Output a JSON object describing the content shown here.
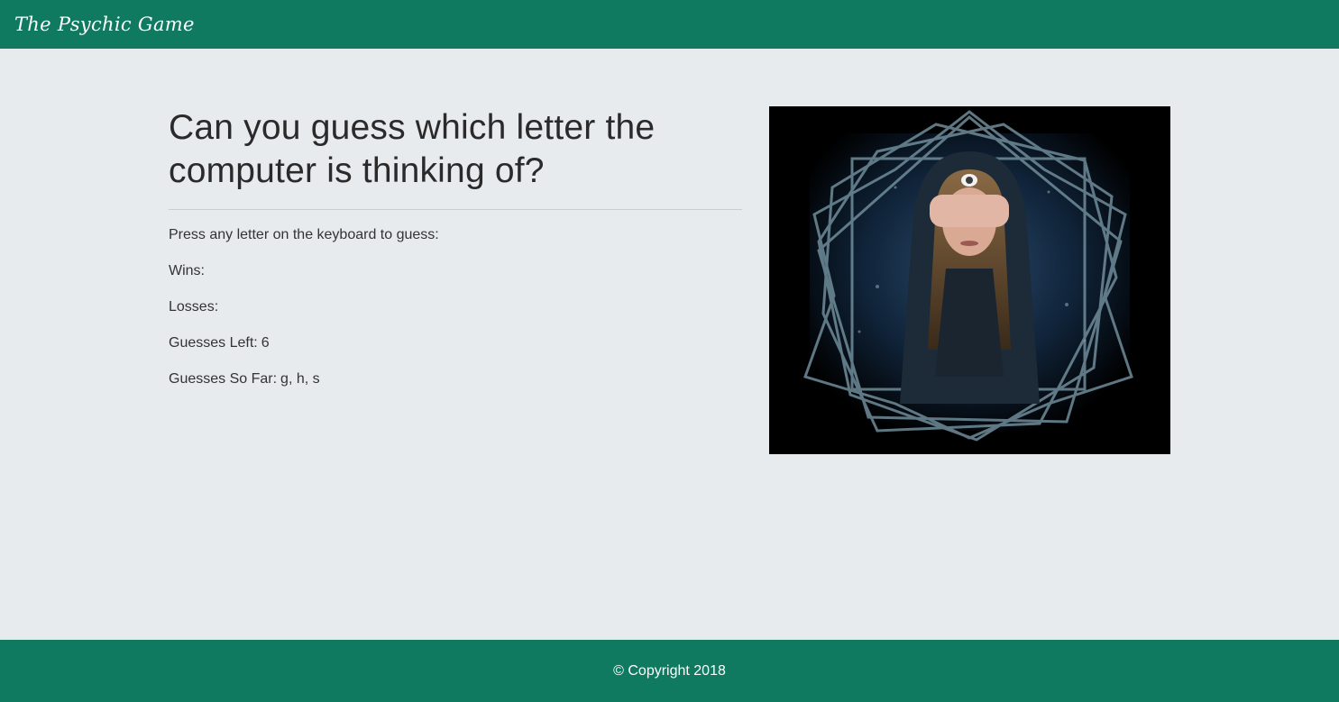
{
  "navbar": {
    "brand": "The Psychic Game"
  },
  "main": {
    "headline": "Can you guess which letter the computer is thinking of?",
    "instruction": "Press any letter on the keyboard to guess:",
    "stats": {
      "wins_label": "Wins:",
      "wins_value": "",
      "losses_label": "Losses:",
      "losses_value": "",
      "guesses_left_label": "Guesses Left:",
      "guesses_left_value": "6",
      "guesses_so_far_label": "Guesses So Far:",
      "guesses_so_far_value": "g, h, s"
    }
  },
  "image": {
    "alt": "psychic-eye-hooded-woman-illustration"
  },
  "footer": {
    "copyright": "© Copyright 2018"
  },
  "colors": {
    "brand_green": "#0f7a60",
    "page_bg": "#e8ebee",
    "text": "#2b2b2b"
  }
}
